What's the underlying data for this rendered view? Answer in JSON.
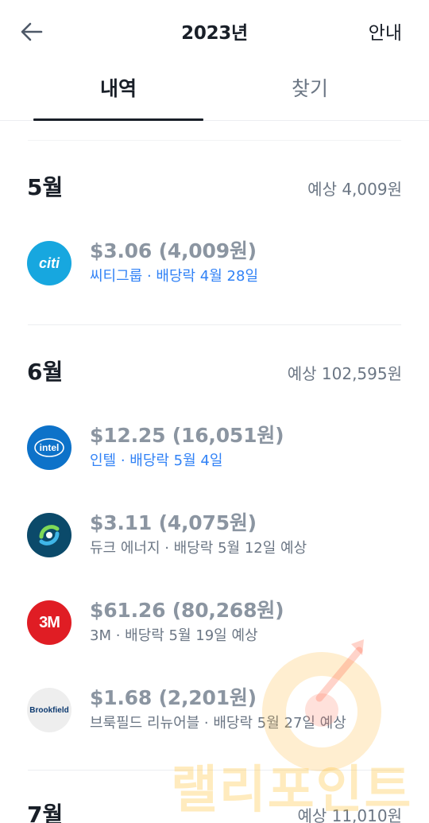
{
  "header": {
    "title": "2023년",
    "info_label": "안내"
  },
  "tabs": [
    {
      "label": "내역",
      "active": true
    },
    {
      "label": "찾기",
      "active": false
    }
  ],
  "months": [
    {
      "title": "5월",
      "expected": "예상 4,009원",
      "items": [
        {
          "logo": "citi-logo",
          "logo_text": "citi",
          "amount": "$3.06 (4,009원)",
          "detail": "씨티그룹 · 배당락 4월 28일",
          "status": "confirmed"
        }
      ]
    },
    {
      "title": "6월",
      "expected": "예상 102,595원",
      "items": [
        {
          "logo": "intel-logo",
          "logo_text": "intel",
          "amount": "$12.25 (16,051원)",
          "detail": "인텔 · 배당락 5월 4일",
          "status": "confirmed"
        },
        {
          "logo": "duke-energy-logo",
          "logo_text": "",
          "amount": "$3.11 (4,075원)",
          "detail": "듀크 에너지 · 배당락 5월 12일 예상",
          "status": "expected"
        },
        {
          "logo": "3m-logo",
          "logo_text": "3M",
          "amount": "$61.26 (80,268원)",
          "detail": "3M · 배당락 5월 19일 예상",
          "status": "expected"
        },
        {
          "logo": "brookfield-logo",
          "logo_text": "Brookfield",
          "amount": "$1.68 (2,201원)",
          "detail": "브룩필드 리뉴어블 · 배당락 5월 27일 예상",
          "status": "expected"
        }
      ]
    },
    {
      "title": "7월",
      "expected": "예상 11,010원",
      "items": []
    }
  ],
  "watermark": "랠리포인트",
  "colors": {
    "accent_blue": "#3182f6",
    "text_primary": "#191f28",
    "text_secondary": "#6b7684",
    "amount_gray": "#8b95a1"
  }
}
